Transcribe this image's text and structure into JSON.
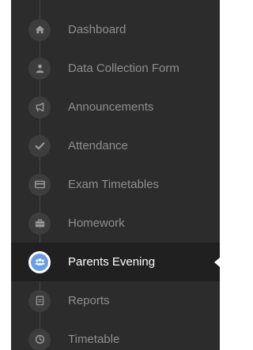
{
  "colors": {
    "sidebar_bg": "#2c2c2c",
    "active_bg": "#202020",
    "icon_bg": "#3d3d3d",
    "icon_fg": "#9a9a9a",
    "active_icon_bg": "#6a9ee0",
    "label_color": "#8f8f8f",
    "active_label_color": "#ffffff"
  },
  "sidebar": {
    "items": [
      {
        "label": "Dashboard",
        "icon": "home-icon",
        "active": false
      },
      {
        "label": "Data Collection Form",
        "icon": "user-icon",
        "active": false
      },
      {
        "label": "Announcements",
        "icon": "megaphone-icon",
        "active": false
      },
      {
        "label": "Attendance",
        "icon": "check-icon",
        "active": false
      },
      {
        "label": "Exam Timetables",
        "icon": "card-icon",
        "active": false
      },
      {
        "label": "Homework",
        "icon": "briefcase-icon",
        "active": false
      },
      {
        "label": "Parents Evening",
        "icon": "users-icon",
        "active": true
      },
      {
        "label": "Reports",
        "icon": "document-icon",
        "active": false
      },
      {
        "label": "Timetable",
        "icon": "clock-icon",
        "active": false
      }
    ]
  }
}
